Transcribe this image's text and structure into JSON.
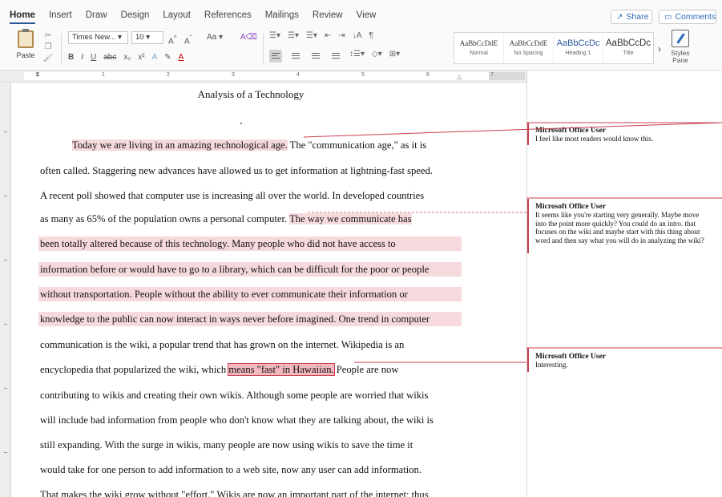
{
  "tabs": [
    "Home",
    "Insert",
    "Draw",
    "Design",
    "Layout",
    "References",
    "Mailings",
    "Review",
    "View"
  ],
  "header_buttons": {
    "share": "Share",
    "comments": "Comments"
  },
  "ribbon": {
    "paste_label": "Paste",
    "font_name": "Times New...",
    "font_size": "10",
    "format_buttons": [
      "B",
      "I",
      "U",
      "abc",
      "x₂",
      "x²",
      "A",
      "A"
    ],
    "styles": [
      {
        "sample": "AaBbCcDdE",
        "name": "Normal"
      },
      {
        "sample": "AaBbCcDdE",
        "name": "No Spacing"
      },
      {
        "sample": "AaBbCcDc",
        "name": "Heading 1"
      },
      {
        "sample": "AaBbCcDc",
        "name": "Title"
      }
    ],
    "styles_pane_label": "Styles Pane"
  },
  "ruler_numbers": [
    "1",
    "2",
    "3",
    "4",
    "5",
    "6",
    "7"
  ],
  "document": {
    "title": "Analysis of a Technology",
    "lines": [
      "Today we are living in an amazing technological age.",
      " The \"communication age,\" as it is",
      "often called. Staggering new advances have allowed us to get information at lightning-fast speed.",
      "A recent poll showed that computer use is increasing all over the world. In developed countries",
      "as many as 65% of the population owns a personal computer. ",
      "The way we communicate has",
      "been totally altered because of this technology. Many people who did not have access to",
      "information before or would have to go to a library, which can be difficult for the poor or people",
      "without transportation. People without the ability to ever communicate their information or",
      "knowledge to the public can now interact in ways never before imagined.",
      " One trend in computer",
      "communication is the wiki, a popular trend that has grown on the internet. Wikipedia is an",
      "encyclopedia that popularized the wiki, which ",
      "means \"fast\" in Hawaiian.",
      " People are now",
      "contributing to wikis and creating their own wikis. Although some people are worried that wikis",
      "will include bad information from people who don't know what they are talking about, the wiki is",
      "still expanding. With the surge in wikis, many people are now using wikis to save the time it",
      "would take for one person to add information to a web site, now any user can add information.",
      "That makes the wiki grow without \"effort.\" Wikis are now an important part of the internet; thus"
    ]
  },
  "comments": [
    {
      "author": "Microsoft Office User",
      "body": [
        "I feel like most readers would know this."
      ]
    },
    {
      "author": "Microsoft Office User",
      "body": [
        "It seems like you're starting very generally. Maybe move",
        "into the point more quickly? You could do an intro. that",
        "focuses on the wiki and maybe start with this thing about",
        "word and then say what you will do in analyzing the wiki?"
      ]
    },
    {
      "author": "Microsoft Office User",
      "body": [
        "Interesting."
      ]
    }
  ],
  "colors": {
    "highlight": "#f6d9dc",
    "comment_accent": "#c9404f",
    "link_blue": "#2b6cb8",
    "heading_blue": "#2b579a"
  }
}
